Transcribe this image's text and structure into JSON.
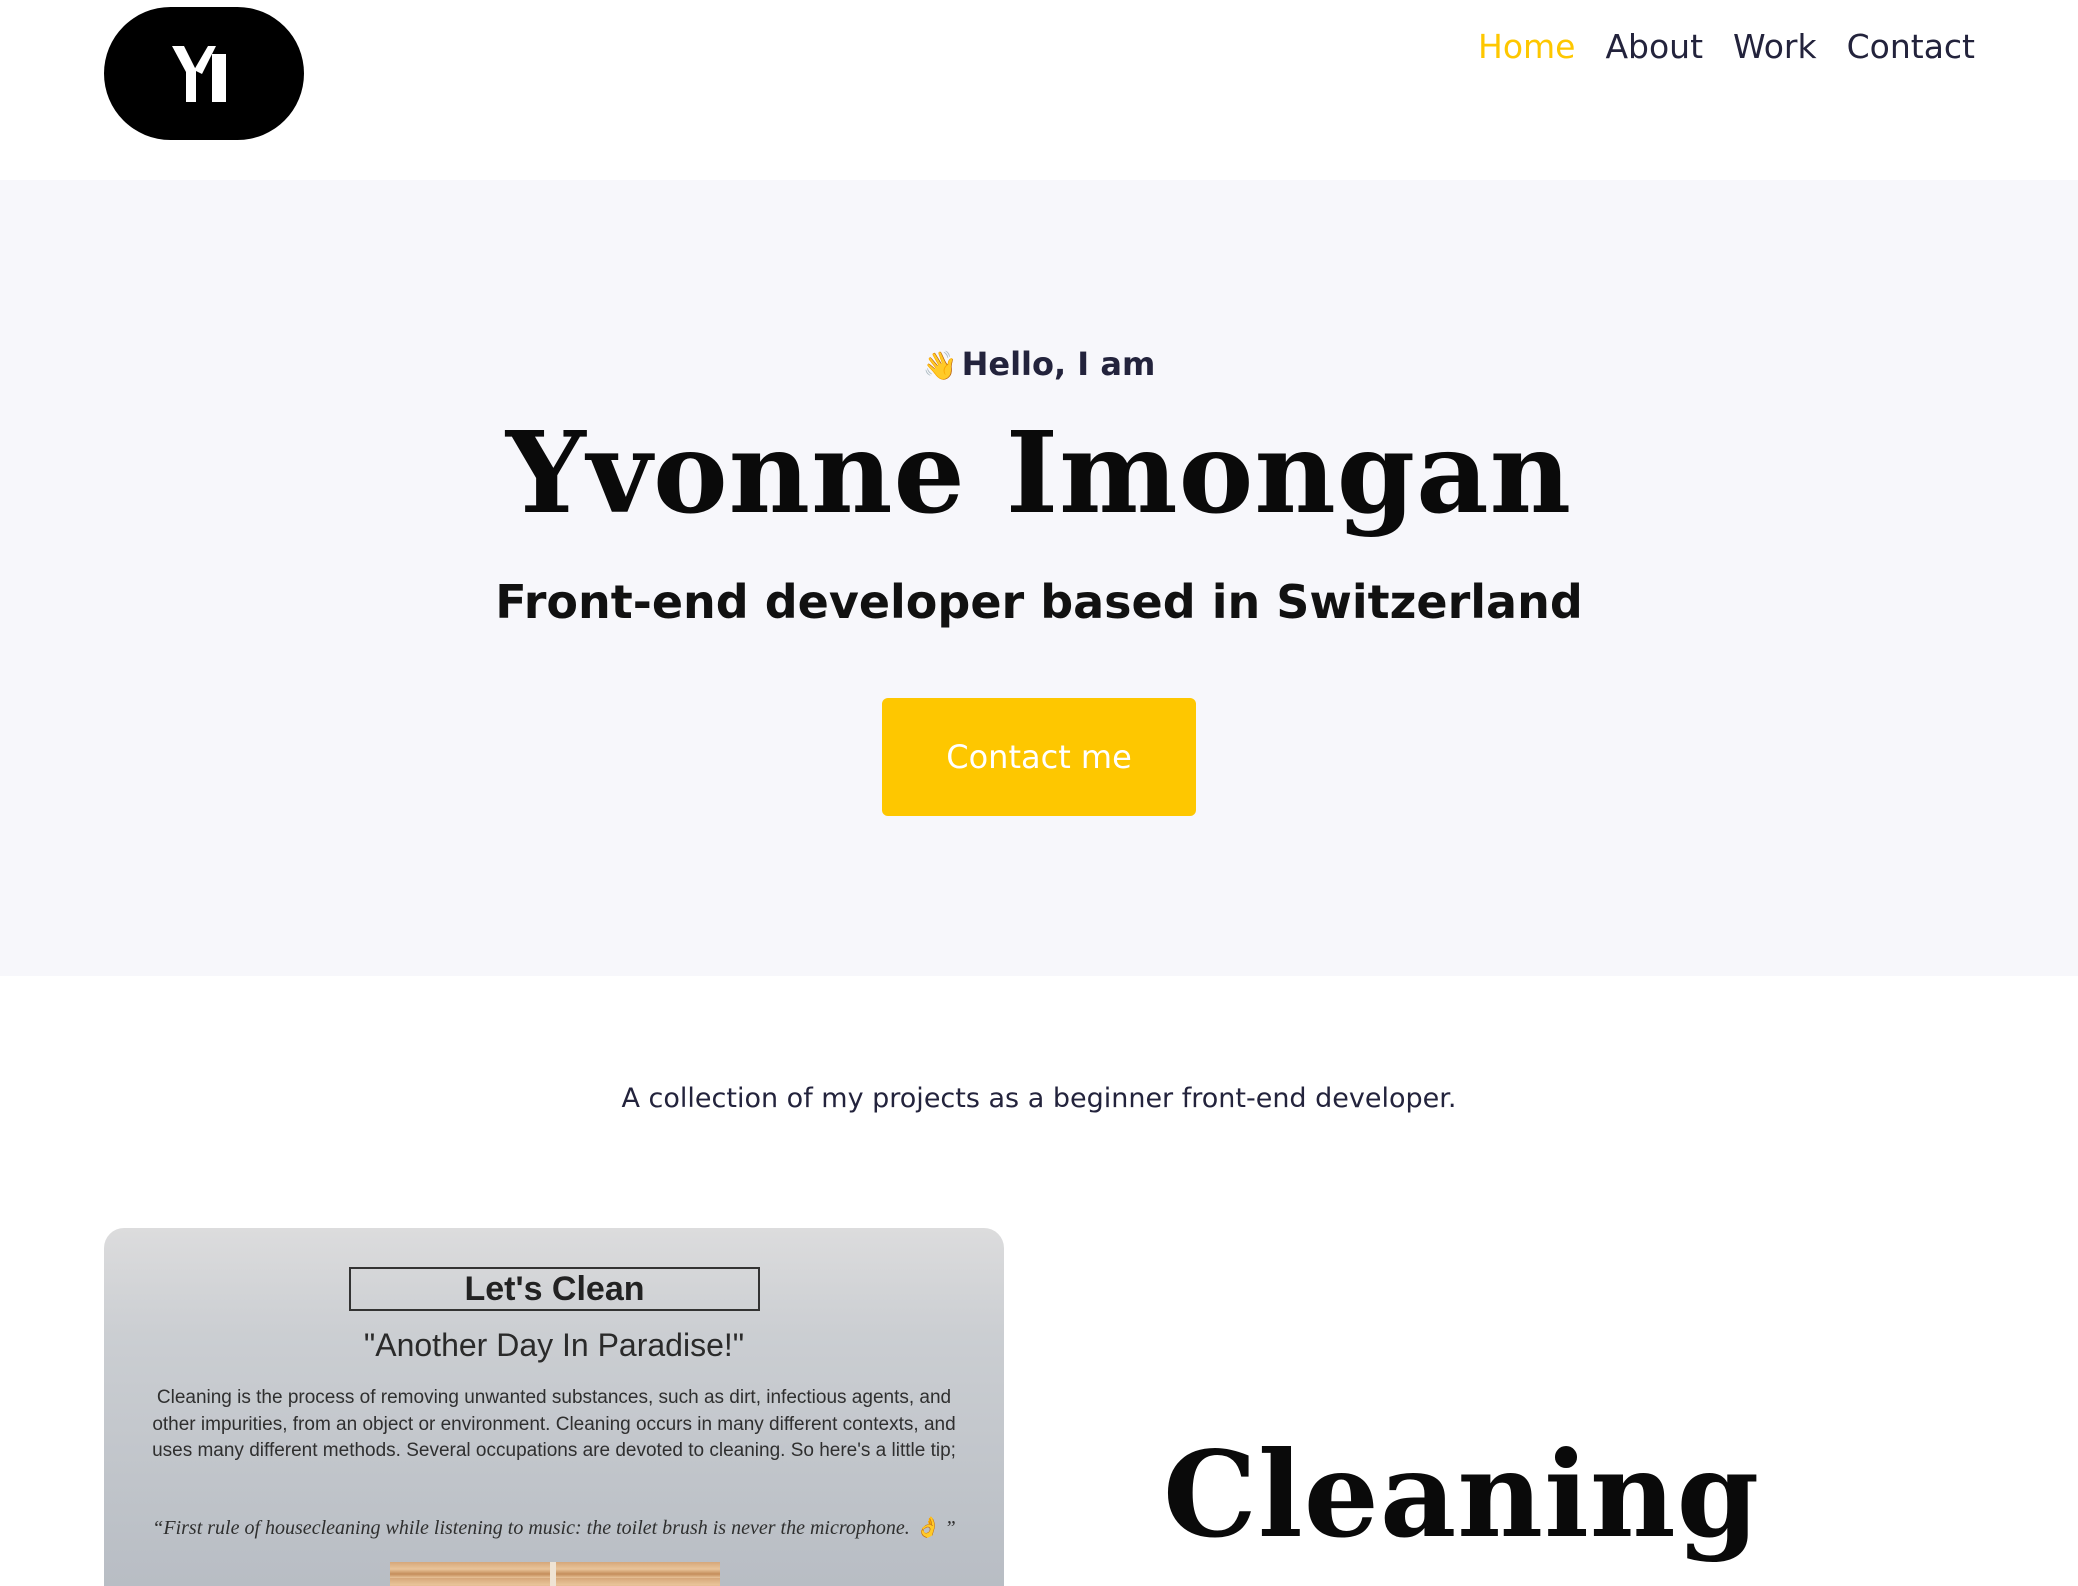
{
  "logo": {
    "text": "YI"
  },
  "nav": {
    "items": [
      {
        "label": "Home",
        "active": true
      },
      {
        "label": "About",
        "active": false
      },
      {
        "label": "Work",
        "active": false
      },
      {
        "label": "Contact",
        "active": false
      }
    ]
  },
  "hero": {
    "greeting_icon": "👋",
    "greeting": "Hello, I am",
    "name": "Yvonne Imongan",
    "subtitle": "Front-end developer based in Switzerland",
    "button_label": "Contact me"
  },
  "work": {
    "intro": "A collection of my projects as a beginner front-end developer.",
    "projects": [
      {
        "preview": {
          "title": "Let's Clean",
          "quote": "\"Another Day In Paradise!\"",
          "body": "Cleaning is the process of removing unwanted substances, such as dirt, infectious agents, and other impurities, from an object or environment. Cleaning occurs in many different contexts, and uses many different methods. Several occupations are devoted to cleaning. So here's a little tip;",
          "tip": "“First rule of housecleaning while listening to music: the toilet brush is never the microphone. 👌 ”"
        },
        "heading": "Cleaning"
      }
    ]
  },
  "colors": {
    "accent": "#fec700",
    "hero_bg": "#f7f7fb",
    "nav_text": "#23233c"
  }
}
